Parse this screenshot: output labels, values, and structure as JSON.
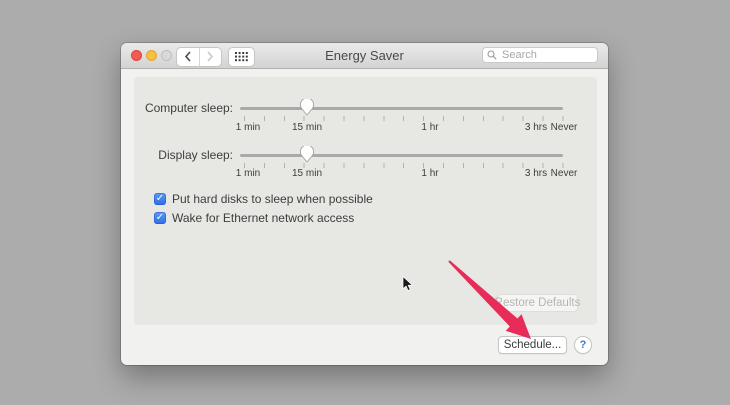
{
  "window": {
    "title": "Energy Saver"
  },
  "toolbar": {
    "search_placeholder": "Search"
  },
  "content": {
    "sliders": [
      {
        "label": "Computer sleep:",
        "tick_labels": [
          "1 min",
          "15 min",
          "1 hr",
          "3 hrs",
          "Never"
        ],
        "value": "15 min"
      },
      {
        "label": "Display sleep:",
        "tick_labels": [
          "1 min",
          "15 min",
          "1 hr",
          "3 hrs",
          "Never"
        ],
        "value": "15 min"
      }
    ],
    "checkboxes": [
      {
        "label": "Put hard disks to sleep when possible",
        "checked": true,
        "check_glyph": "✓"
      },
      {
        "label": "Wake for Ethernet network access",
        "checked": true,
        "check_glyph": "✓"
      }
    ],
    "restore_defaults_label": "Restore Defaults"
  },
  "footer": {
    "schedule_label": "Schedule...",
    "help_label": "?"
  },
  "colors": {
    "checkbox_blue": "#3a7df0",
    "annotation_arrow": "#e72c5a",
    "desktop_gray": "#acacac"
  }
}
